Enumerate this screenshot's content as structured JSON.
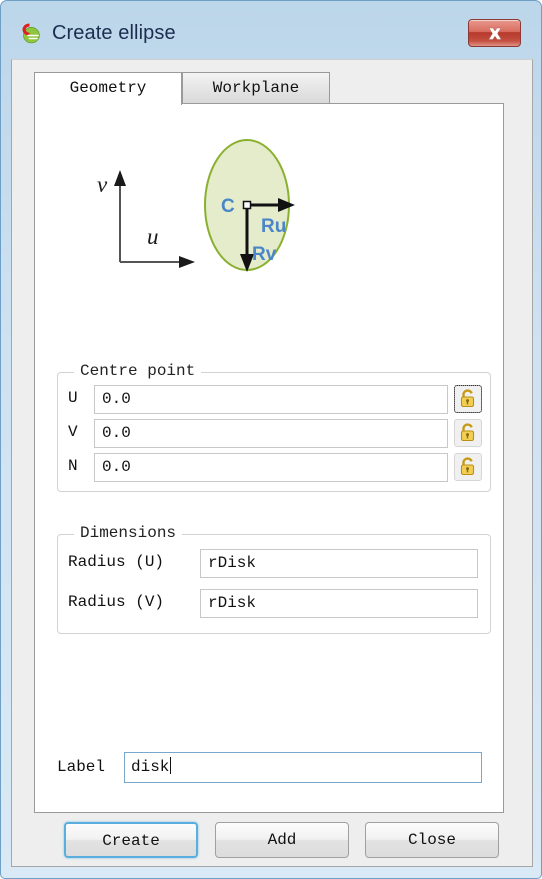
{
  "window": {
    "title": "Create ellipse",
    "app_icon": "comsol-logo-icon",
    "close_label": "✕",
    "frame_color": "#cfe2f2",
    "titlebar_text_color": "#1b2e50"
  },
  "tabs": [
    {
      "label": "Geometry",
      "active": true
    },
    {
      "label": "Workplane",
      "active": false
    }
  ],
  "diagram": {
    "alt": "ellipse-geometry-diagram",
    "axis_u_label": "u",
    "axis_v_label": "v",
    "center_label": "C",
    "radius_u_label": "Ru",
    "radius_v_label": "Rv",
    "ellipse_fill": "#e4eccb",
    "ellipse_stroke": "#8ab02f",
    "annotation_color": "#4a86c8",
    "arrow_color": "#111111",
    "axis_color": "#555555"
  },
  "centre_point": {
    "title": "Centre point",
    "rows": [
      {
        "label": "U",
        "value": "0.0",
        "lock_icon": "padlock-open-icon",
        "lock_focused": true
      },
      {
        "label": "V",
        "value": "0.0",
        "lock_icon": "padlock-open-icon",
        "lock_focused": false
      },
      {
        "label": "N",
        "value": "0.0",
        "lock_icon": "padlock-open-icon",
        "lock_focused": false
      }
    ]
  },
  "dimensions": {
    "title": "Dimensions",
    "rows": [
      {
        "label": "Radius (U)",
        "value": "rDisk"
      },
      {
        "label": "Radius (V)",
        "value": "rDisk"
      }
    ]
  },
  "label_field": {
    "caption": "Label",
    "value": "disk",
    "focused": true
  },
  "buttons": [
    {
      "label": "Create",
      "default": true
    },
    {
      "label": "Add",
      "default": false
    },
    {
      "label": "Close",
      "default": false
    }
  ]
}
